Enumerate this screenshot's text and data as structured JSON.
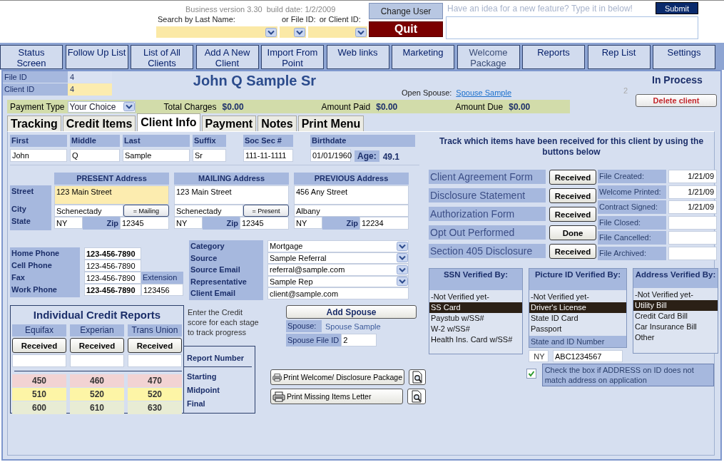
{
  "header": {
    "version": "Business version 3.30",
    "build_date": "build date: 1/2/2009",
    "search": [
      {
        "label": "Search by Last Name:"
      },
      {
        "label": "or File ID:"
      },
      {
        "label": "or Client ID:"
      }
    ],
    "change_user": "Change User",
    "quit": "Quit",
    "feedback_prompt": "Have an idea for a new feature? Type it in below!",
    "submit": "Submit"
  },
  "nav": [
    {
      "label": "Status\nScreen",
      "disabled": false
    },
    {
      "label": "Follow Up List",
      "disabled": false
    },
    {
      "label": "List of All\nClients",
      "disabled": false
    },
    {
      "label": "Add A New\nClient",
      "disabled": false
    },
    {
      "label": "Import From\nPoint",
      "disabled": false
    },
    {
      "label": "Web links",
      "disabled": false
    },
    {
      "label": "Marketing",
      "disabled": false
    },
    {
      "label": "Welcome\nPackage",
      "disabled": true
    },
    {
      "label": "Reports",
      "disabled": false
    },
    {
      "label": "Rep List",
      "disabled": false
    },
    {
      "label": "Settings",
      "disabled": false
    }
  ],
  "record": {
    "file_id_label": "File ID",
    "file_id": "4",
    "client_id_label": "Client ID",
    "client_id": "4",
    "client_id_highlighted": true,
    "name": "John Q Sample Sr",
    "open_spouse_label": "Open Spouse:",
    "open_spouse_link": "Spouse Sample",
    "spouse_count": "2",
    "status": "In Process",
    "delete_button": "Delete client"
  },
  "payment_bar": {
    "type_label": "Payment Type",
    "type_value": "Your Choice",
    "totals": [
      {
        "label": "Total Charges",
        "value": "$0.00"
      },
      {
        "label": "Amount Paid",
        "value": "$0.00"
      },
      {
        "label": "Amount Due",
        "value": "$0.00"
      }
    ]
  },
  "tabs": [
    {
      "label": "Tracking",
      "selected": false
    },
    {
      "label": "Credit Items",
      "selected": false
    },
    {
      "label": "Client Info",
      "selected": true
    },
    {
      "label": "Payment",
      "selected": false
    },
    {
      "label": "Notes",
      "selected": false
    },
    {
      "label": "Print Menu",
      "selected": false
    }
  ],
  "name_fields": [
    {
      "label": "First",
      "value": "John"
    },
    {
      "label": "Middle",
      "value": "Q"
    },
    {
      "label": "Last",
      "value": "Sample"
    },
    {
      "label": "Suffix",
      "value": "Sr"
    },
    {
      "label": "Soc Sec #",
      "value": "111-11-1111"
    }
  ],
  "birthdate": {
    "label": "Birthdate",
    "value": "01/01/1960",
    "age_label": "Age:",
    "age": "49.1"
  },
  "address_row_labels": [
    "Street",
    "City",
    "State"
  ],
  "addresses": [
    {
      "header": "PRESENT Address",
      "street": "123 Main Street",
      "highlighted": true,
      "city": "Schenectady",
      "copy_button": "= Mailing",
      "state": "NY",
      "zip_label": "Zip",
      "zip": "12345"
    },
    {
      "header": "MAILING Address",
      "street": "123 Main Street",
      "highlighted": false,
      "city": "Schenectady",
      "copy_button": "= Present",
      "state": "NY",
      "zip_label": "Zip",
      "zip": "12345"
    },
    {
      "header": "PREVIOUS Address",
      "street": "456 Any Street",
      "highlighted": false,
      "city": "Albany",
      "state": "NY",
      "zip_label": "Zip",
      "zip": "12234"
    }
  ],
  "phones": [
    {
      "label": "Home Phone",
      "value": "123-456-7890",
      "emphasis": true
    },
    {
      "label": "Cell Phone",
      "value": "123-456-7890",
      "emphasis": false
    },
    {
      "label": "Fax",
      "value": "123-456-7890",
      "emphasis": false
    },
    {
      "label": "Work Phone",
      "value": "123-456-7890",
      "emphasis": true
    }
  ],
  "extension": {
    "label": "Extension",
    "value": "123456"
  },
  "details": [
    {
      "label": "Category",
      "value": "Mortgage",
      "dropdown": true
    },
    {
      "label": "Source",
      "value": "Sample Referral",
      "dropdown": true
    },
    {
      "label": "Source Email",
      "value": "referral@sample.com",
      "dropdown": true
    },
    {
      "label": "Representative",
      "value": "Sample Rep",
      "dropdown": true
    },
    {
      "label": "Client Email",
      "value": "client@sample.com",
      "dropdown": false
    }
  ],
  "credit_reports": {
    "title": "Individual Credit Reports",
    "bureaus": [
      {
        "name": "Equifax",
        "button": "Received",
        "scores": [
          "450",
          "510",
          "600"
        ]
      },
      {
        "name": "Experian",
        "button": "Received",
        "scores": [
          "460",
          "520",
          "610"
        ]
      },
      {
        "name": "Trans Union",
        "button": "Received",
        "scores": [
          "470",
          "520",
          "630"
        ]
      }
    ],
    "report_number_label": "Report Number",
    "stages": [
      {
        "label": "Starting",
        "color": "#f2d3d3"
      },
      {
        "label": "Midpoint",
        "color": "#fdf5a6"
      },
      {
        "label": "Final",
        "color": "#e8ecd4"
      }
    ]
  },
  "credit_note": "Enter the Credit score for each stage to track progress",
  "spouse": {
    "add_button": "Add Spouse",
    "label": "Spouse:",
    "name": "Spouse Sample",
    "file_id_label": "Spouse File ID",
    "file_id": "2"
  },
  "print_buttons": [
    {
      "label": "Print Welcome/ Disclosure Package"
    },
    {
      "label": "Print Missing Items Letter"
    }
  ],
  "tracking": {
    "instruction": "Track which items have been received for this client by using the buttons below",
    "documents": [
      {
        "label": "Client Agreement Form",
        "button": "Received"
      },
      {
        "label": "Disclosure Statement",
        "button": "Received"
      },
      {
        "label": "Authorization Form",
        "button": "Received"
      },
      {
        "label": "Opt Out Performed",
        "button": "Done"
      },
      {
        "label": "Section 405 Disclosure",
        "button": "Received"
      }
    ],
    "dates": [
      {
        "label": "File Created:",
        "value": "1/21/09"
      },
      {
        "label": "Welcome Printed:",
        "value": "1/21/09"
      },
      {
        "label": "Contract Signed:",
        "value": "1/21/09"
      },
      {
        "label": "File Closed:"
      },
      {
        "label": "File Cancelled:"
      },
      {
        "label": "File Archived:"
      }
    ]
  },
  "verification": [
    {
      "title": "SSN Verified By:",
      "options": [
        {
          "label": "-Not Verified yet-",
          "selected": false
        },
        {
          "label": "SS Card",
          "selected": true
        },
        {
          "label": "Paystub w/SS#",
          "selected": false
        },
        {
          "label": "W-2 w/SS#",
          "selected": false
        },
        {
          "label": "Health Ins. Card w/SS#",
          "selected": false
        }
      ]
    },
    {
      "title": "Picture ID Verified By:",
      "options": [
        {
          "label": "-Not Verified yet-",
          "selected": false
        },
        {
          "label": "Driver's License",
          "selected": true
        },
        {
          "label": "State ID Card",
          "selected": false
        },
        {
          "label": "Passport",
          "selected": false
        }
      ],
      "id_label": "State  and ID Number",
      "id_state": "NY",
      "id_number": "ABC1234567"
    },
    {
      "title": "Address Verified By:",
      "options": [
        {
          "label": "-Not Verified yet-",
          "selected": false
        },
        {
          "label": "Utility Bill",
          "selected": true
        },
        {
          "label": "Credit Card Bill",
          "selected": false
        },
        {
          "label": "Car Insurance Bill",
          "selected": false
        },
        {
          "label": "Other",
          "selected": false
        }
      ]
    }
  ],
  "address_mismatch": {
    "checked": true,
    "text": "Check the box if ADDRESS on ID does not match address on application"
  }
}
